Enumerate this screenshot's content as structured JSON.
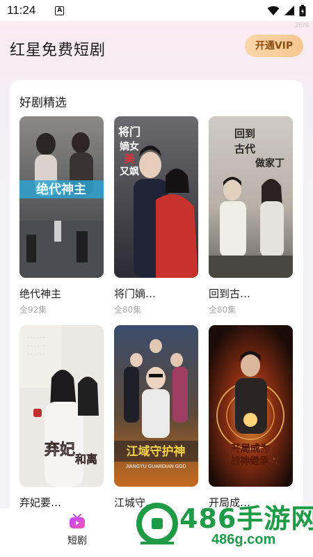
{
  "status": {
    "time": "11:24",
    "notification_icon": "A",
    "corner_tag": "2576"
  },
  "header": {
    "title": "红星免费短剧",
    "vip_label": "开通VIP"
  },
  "section": {
    "title": "好剧精选"
  },
  "dramas": [
    {
      "title": "绝代神主",
      "episodes": "全92集",
      "poster_text": "绝代神主"
    },
    {
      "title": "将门嫡…",
      "episodes": "全80集",
      "poster_text": "将门嫡女美又飒"
    },
    {
      "title": "回到古…",
      "episodes": "全80集",
      "poster_text": "回到古代做家丁"
    },
    {
      "title": "弃妃要…",
      "episodes": "",
      "poster_text": "弃妃要和离"
    },
    {
      "title": "江城守…",
      "episodes": "",
      "poster_text": "江域守护神",
      "poster_subtext": "JIANGYU GUARDIAN GOD"
    },
    {
      "title": "开局成…",
      "episodes": "",
      "poster_text": "开局成为战神继承人"
    }
  ],
  "bottom_nav": {
    "tab_label": "短剧"
  },
  "watermark": {
    "brand": "486手游网",
    "url": "486g.com"
  },
  "colors": {
    "vip_bg": "#f6c792",
    "vip_text": "#8a4d12",
    "watermark": "#1f9a47",
    "nav_icon": "#d93df0"
  }
}
